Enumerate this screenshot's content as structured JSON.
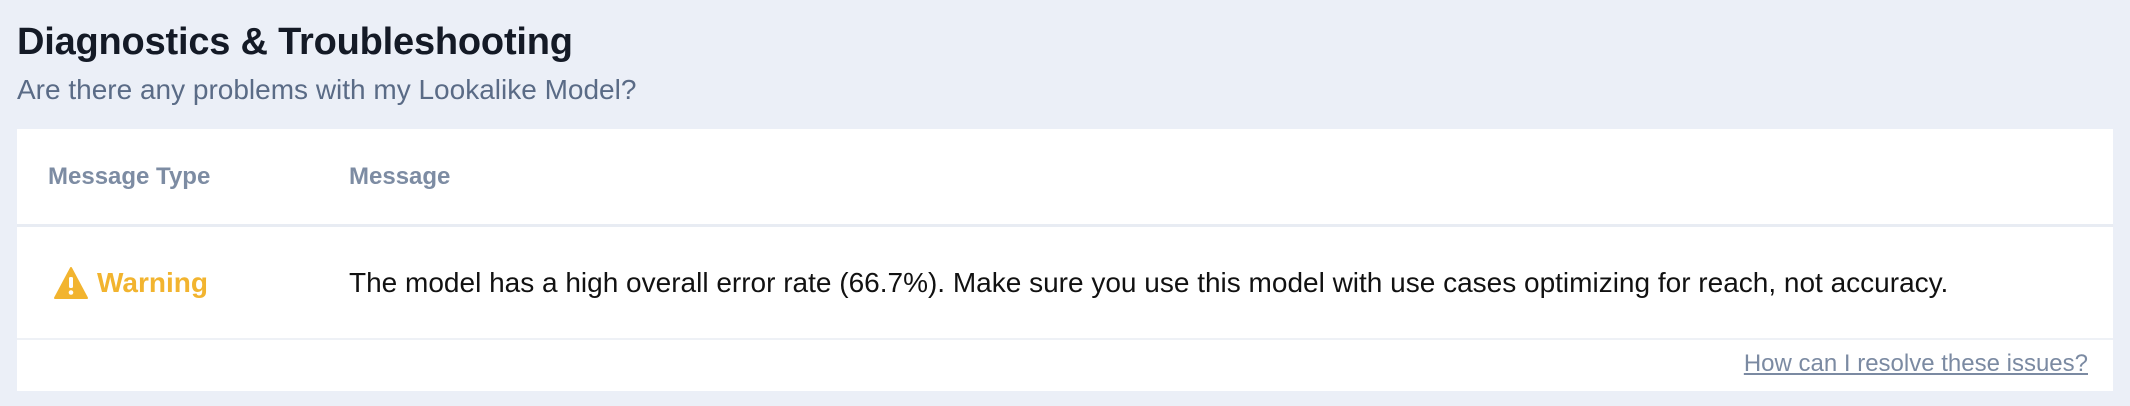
{
  "section": {
    "title": "Diagnostics & Troubleshooting",
    "subtitle": "Are there any problems with my Lookalike Model?"
  },
  "table": {
    "headers": {
      "type": "Message Type",
      "message": "Message"
    },
    "rows": [
      {
        "type": "Warning",
        "icon": "warning-icon",
        "type_color": "#f2b42f",
        "message": "The model has a high overall error rate (66.7%). Make sure you use this model with use cases optimizing for reach, not accuracy."
      }
    ]
  },
  "footer": {
    "help_link": "How can I resolve these issues?"
  },
  "colors": {
    "background": "#ebeff7",
    "card": "#ffffff",
    "title": "#141a26",
    "subtitle": "#5a6b86",
    "header_text": "#7d8ca3",
    "warning": "#f2b42f",
    "link": "#7b8aa2"
  }
}
